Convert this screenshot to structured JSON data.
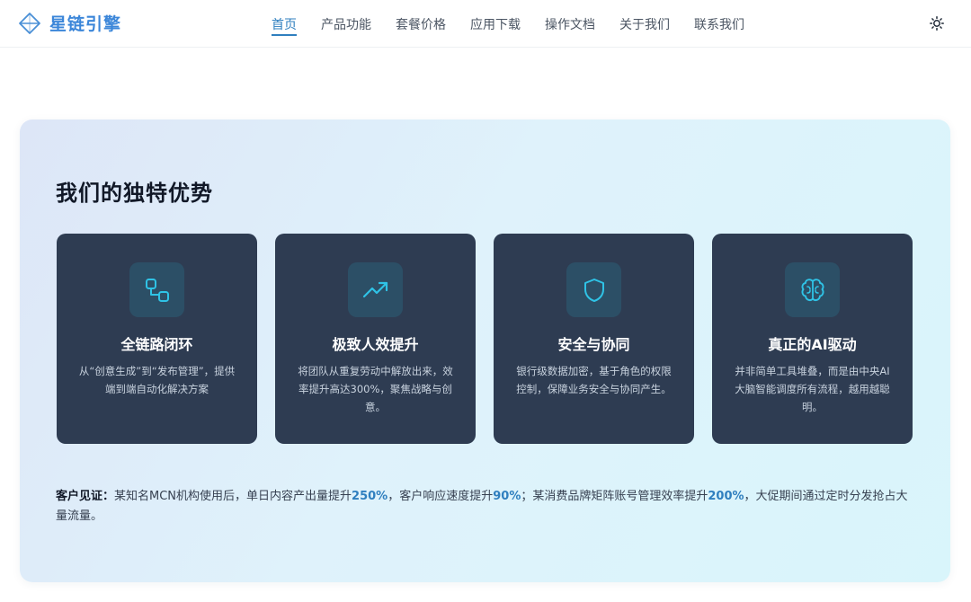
{
  "brand": {
    "name": "星链引擎",
    "logo_icon": "diamond-logo-icon",
    "color": "#3b86d9"
  },
  "nav": {
    "items": [
      {
        "label": "首页",
        "active": true
      },
      {
        "label": "产品功能",
        "active": false
      },
      {
        "label": "套餐价格",
        "active": false
      },
      {
        "label": "应用下载",
        "active": false
      },
      {
        "label": "操作文档",
        "active": false
      },
      {
        "label": "关于我们",
        "active": false
      },
      {
        "label": "联系我们",
        "active": false
      }
    ],
    "theme_toggle_icon": "sun-icon"
  },
  "advantages": {
    "title": "我们的独特优势",
    "cards": [
      {
        "icon": "link-nodes-icon",
        "title": "全链路闭环",
        "desc": "从“创意生成”到“发布管理”，提供端到端自动化解决方案"
      },
      {
        "icon": "trending-up-icon",
        "title": "极致人效提升",
        "desc": "将团队从重复劳动中解放出来，效率提升高达300%，聚焦战略与创意。"
      },
      {
        "icon": "shield-icon",
        "title": "安全与协同",
        "desc": "银行级数据加密，基于角色的权限控制，保障业务安全与协同产生。"
      },
      {
        "icon": "brain-icon",
        "title": "真正的AI驱动",
        "desc": "并非简单工具堆叠，而是由中央AI大脑智能调度所有流程，越用越聪明。"
      }
    ]
  },
  "testimonial": {
    "label": "客户见证：",
    "part1": "某知名MCN机构使用后，单日内容产出量提升",
    "stat1": "250%",
    "part2": "，客户响应速度提升",
    "stat2": "90%",
    "part3": "；某消费品牌矩阵账号管理效率提升",
    "stat3": "200%",
    "part4": "，大促期间通过定时分发抢占大量流量。"
  },
  "colors": {
    "accent": "#2f7fbf",
    "card_bg": "#2e3c52",
    "icon_box_bg": "#2c4f66",
    "icon_stroke": "#2fc3e6"
  }
}
